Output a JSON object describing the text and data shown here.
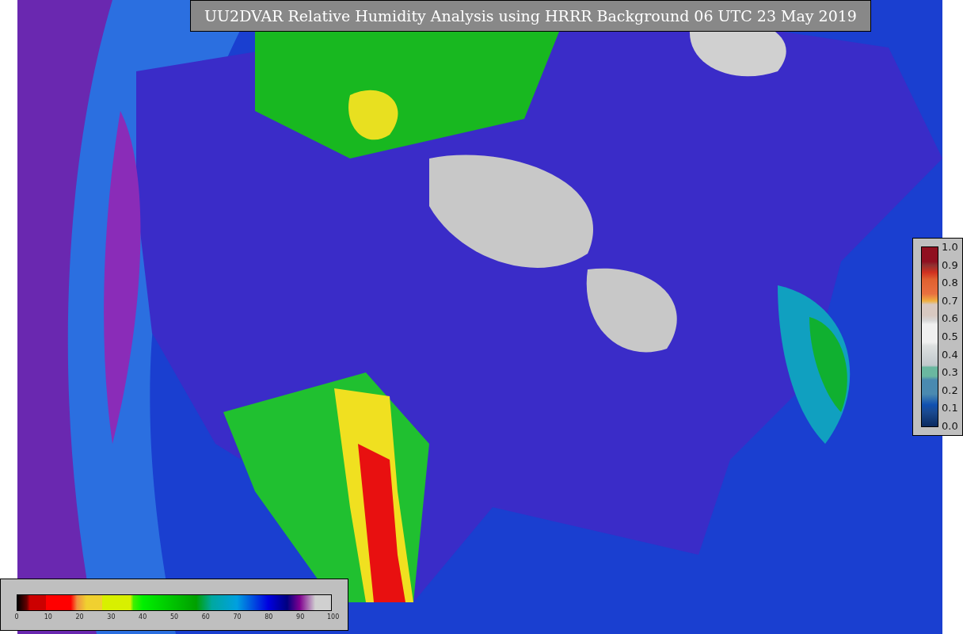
{
  "title": "UU2DVAR Relative Humidity Analysis using HRRR Background 06 UTC 23 May 2019",
  "humidity_colorbar": {
    "ticks": [
      "0",
      "10",
      "20",
      "30",
      "40",
      "50",
      "60",
      "70",
      "80",
      "90",
      "100"
    ]
  },
  "observation_colorbar": {
    "ticks": [
      "1.0",
      "0.9",
      "0.8",
      "0.7",
      "0.6",
      "0.5",
      "0.4",
      "0.3",
      "0.2",
      "0.1",
      "0.0"
    ]
  }
}
